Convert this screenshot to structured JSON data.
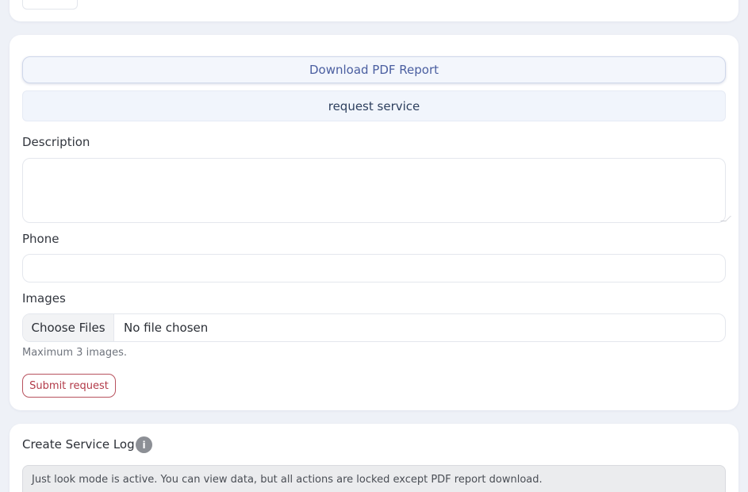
{
  "request_card": {
    "download_label": "Download PDF Report",
    "request_label": "request service",
    "description_label": "Description",
    "description_value": "",
    "phone_label": "Phone",
    "phone_value": "",
    "images_label": "Images",
    "choose_files_label": "Choose Files",
    "file_status": "No file chosen",
    "images_hint": "Maximum 3 images.",
    "submit_label": "Submit request"
  },
  "service_log": {
    "title": "Create Service Log",
    "info_icon": "info-icon",
    "info_glyph": "i",
    "notice": "Just look mode is active. You can view data, but all actions are locked except PDF report download."
  },
  "colors": {
    "background": "#eef1f7",
    "download_text": "#4a5ea0",
    "request_text": "#2d3f5e",
    "submit_accent": "#b23a48"
  }
}
